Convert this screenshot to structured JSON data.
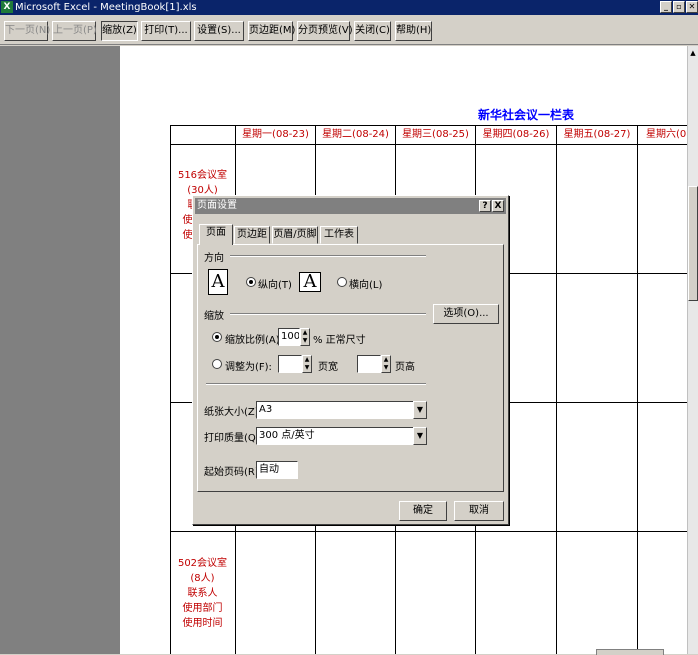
{
  "window": {
    "title": "Microsoft Excel - MeetingBook[1].xls",
    "app_icon": "excel-icon",
    "controls": [
      "_",
      "▫",
      "✕"
    ]
  },
  "toolbar": {
    "buttons": [
      {
        "label": "下一页(N)",
        "enabled": false
      },
      {
        "label": "上一页(P)",
        "enabled": false
      },
      {
        "label": "缩放(Z)",
        "enabled": true,
        "pressed": true
      },
      {
        "label": "打印(T)...",
        "enabled": true
      },
      {
        "label": "设置(S)...",
        "enabled": true
      },
      {
        "label": "页边距(M)",
        "enabled": true
      },
      {
        "label": "分页预览(V)",
        "enabled": true
      },
      {
        "label": "关闭(C)",
        "enabled": true
      },
      {
        "label": "帮助(H)",
        "enabled": true
      }
    ]
  },
  "sheet": {
    "title": "新华社会议一栏表",
    "headers": [
      "星期一(08-23)",
      "星期二(08-24)",
      "星期三(08-25)",
      "星期四(08-26)",
      "星期五(08-27)",
      "星期六(08"
    ],
    "rooms": [
      {
        "lines": [
          "516会议室",
          "(30人)",
          "联系人",
          "使用部门",
          "使用时间"
        ]
      },
      {
        "lines": [
          "5",
          "(",
          "联",
          "使",
          "使"
        ]
      },
      {
        "lines": [
          "10",
          "(",
          "联",
          "使",
          "使"
        ]
      },
      {
        "lines": [
          "502会议室",
          "(8人)",
          "联系人",
          "使用部门",
          "使用时间"
        ]
      }
    ]
  },
  "dialog": {
    "title": "页面设置",
    "help_button": "?",
    "close_button": "X",
    "tabs": [
      "页面",
      "页边距",
      "页眉/页脚",
      "工作表"
    ],
    "active_tab": "页面",
    "orientation": {
      "group_label": "方向",
      "portrait_label": "纵向(T)",
      "landscape_label": "横向(L)",
      "selected": "portrait",
      "icon_letter": "A"
    },
    "scaling": {
      "group_label": "缩放",
      "options_button": "选项(O)...",
      "adjust_to_label": "缩放比例(A):",
      "adjust_to_value": "100",
      "adjust_to_suffix": "% 正常尺寸",
      "fit_to_label": "调整为(F):",
      "fit_wide_value": "",
      "fit_wide_suffix": "页宽",
      "fit_tall_value": "",
      "fit_tall_suffix": "页高",
      "selected": "adjust"
    },
    "paper_size": {
      "label": "纸张大小(Z):",
      "value": "A3"
    },
    "print_quality": {
      "label": "打印质量(Q):",
      "value": "300 点/英寸"
    },
    "first_page": {
      "label": "起始页码(R):",
      "value": "自动"
    },
    "ok_button": "确定",
    "cancel_button": "取消"
  }
}
